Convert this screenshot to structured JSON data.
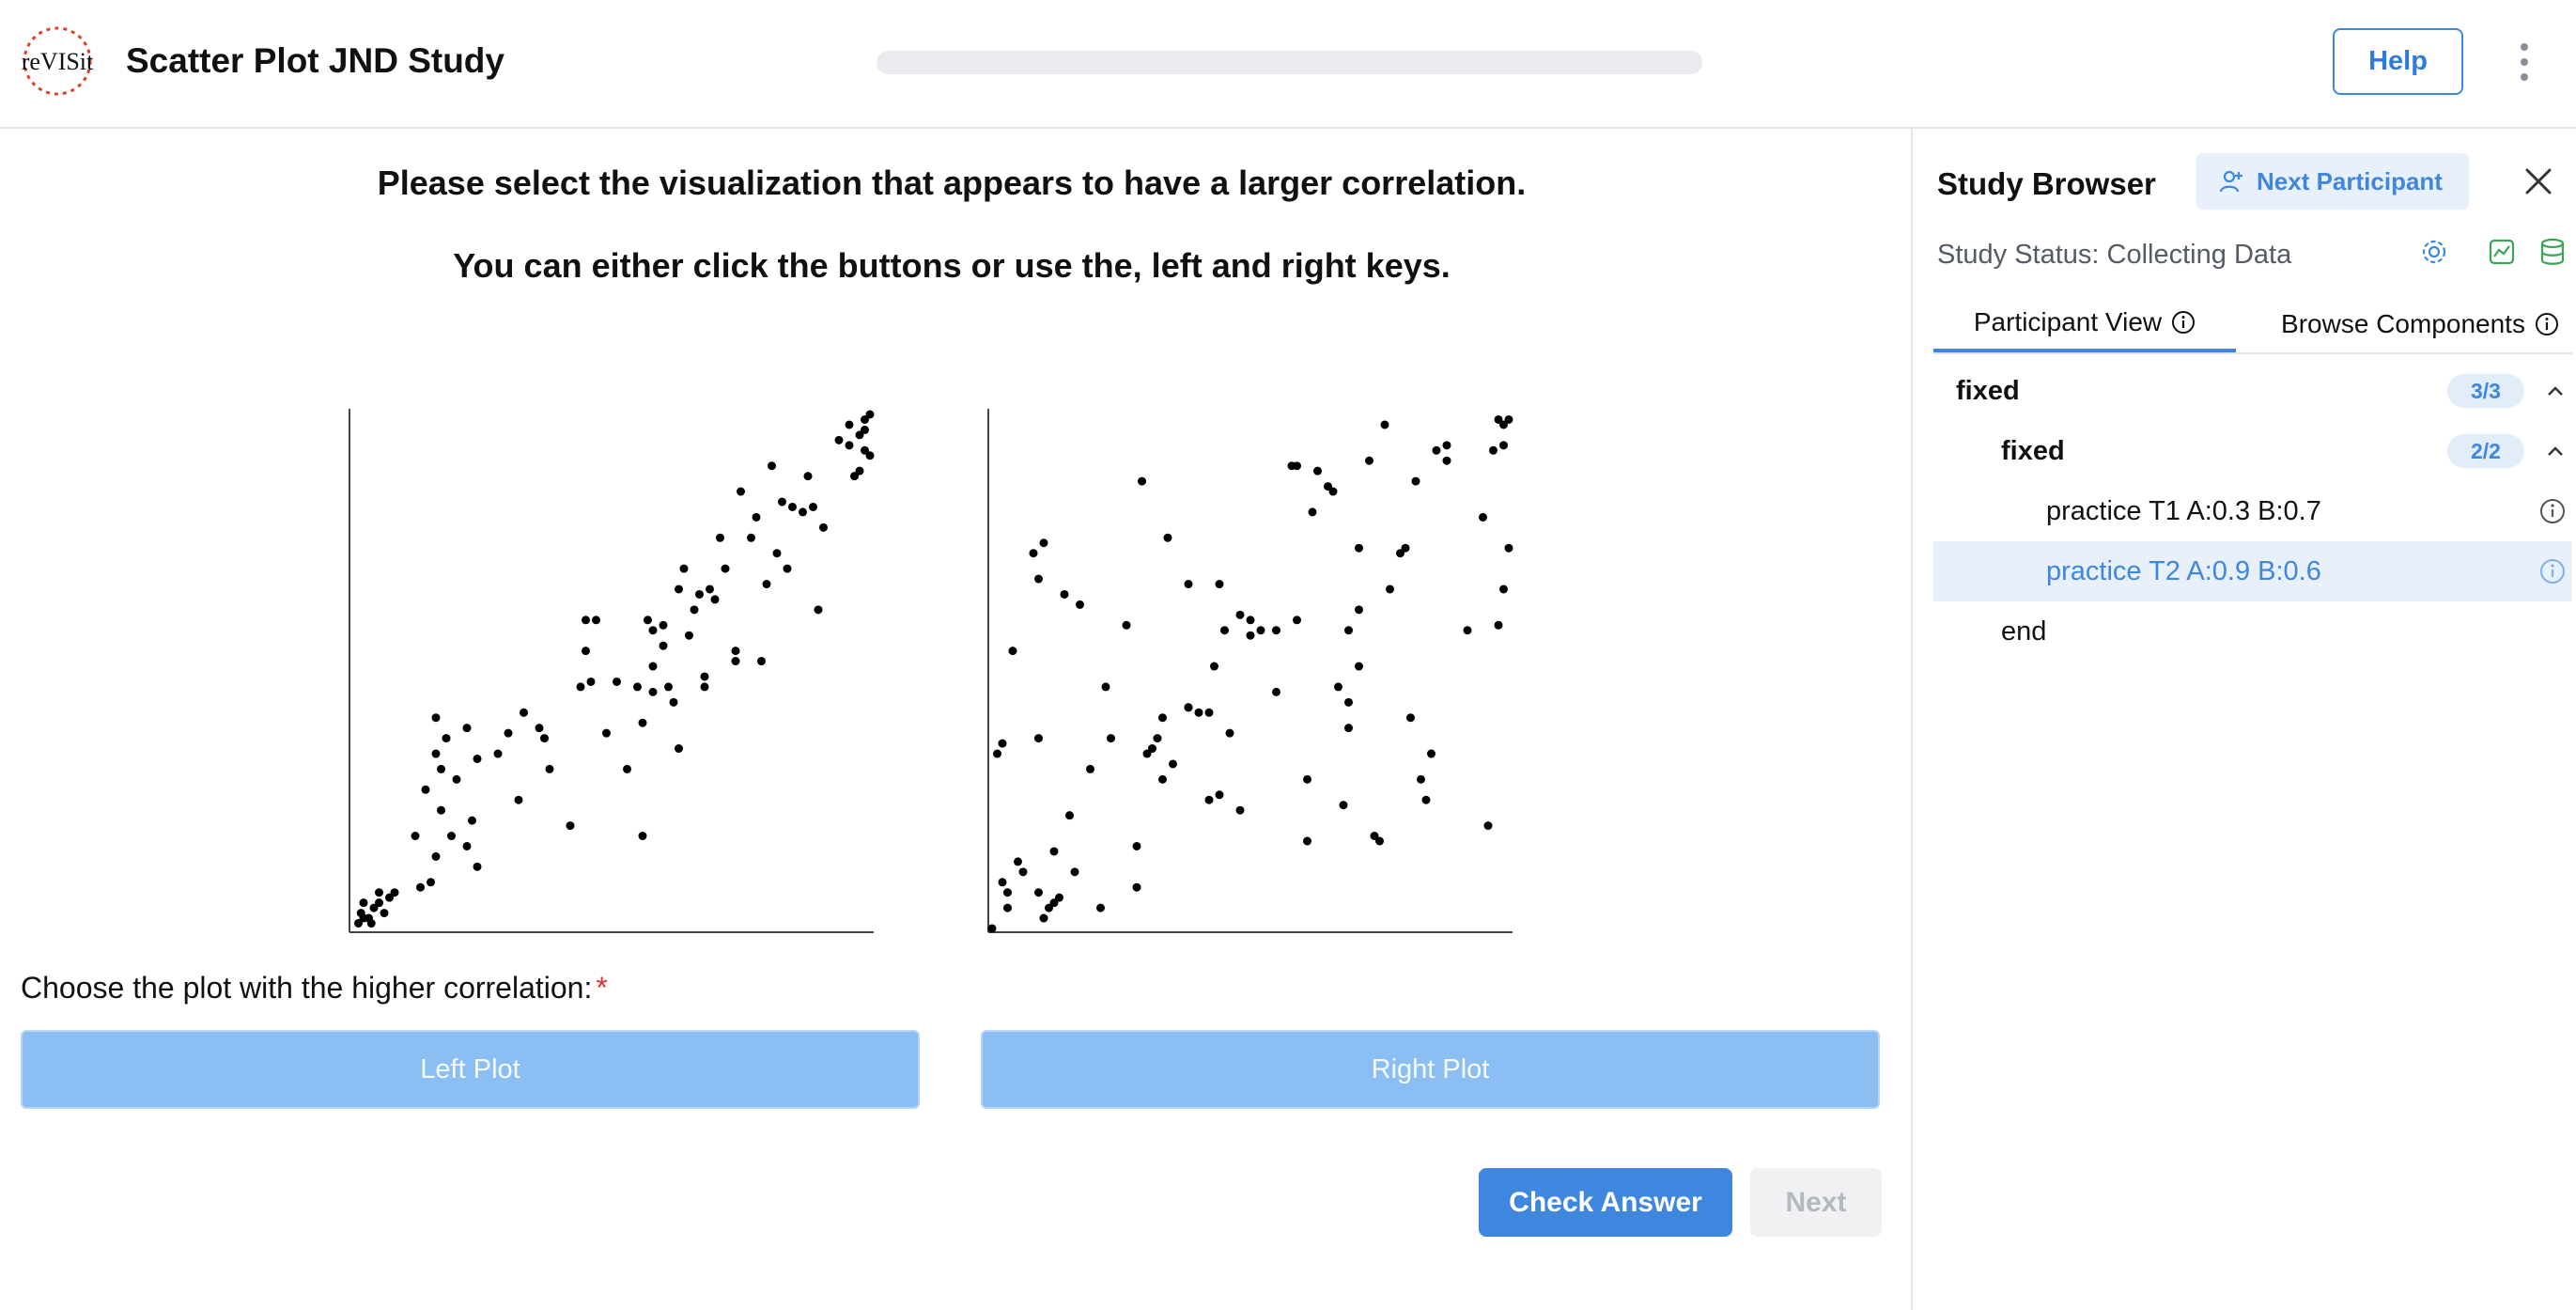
{
  "header": {
    "title": "Scatter Plot JND Study",
    "progress": 0.0,
    "help_label": "Help"
  },
  "main": {
    "instruction_1": "Please select the visualization that appears to have a larger correlation.",
    "instruction_2": "You can either click the buttons or use the, left and right keys.",
    "question": "Choose the plot with the higher correlation:",
    "required_mark": "*",
    "left_choice": "Left Plot",
    "right_choice": "Right Plot",
    "check_answer_label": "Check Answer",
    "next_label": "Next"
  },
  "sidebar": {
    "title": "Study Browser",
    "next_participant_label": "Next Participant",
    "status_text": "Study Status: Collecting Data",
    "tabs": [
      {
        "label": "Participant View",
        "active": true
      },
      {
        "label": "Browse Components",
        "active": false
      }
    ],
    "tree": {
      "group_1": {
        "label": "fixed",
        "badge": "3/3"
      },
      "group_2": {
        "label": "fixed",
        "badge": "2/2"
      },
      "items": [
        {
          "label": "practice T1 A:0.3 B:0.7",
          "selected": false
        },
        {
          "label": "practice T2 A:0.9 B:0.6",
          "selected": true
        }
      ],
      "end_label": "end"
    }
  },
  "colors": {
    "accent": "#3f87de",
    "choice_button": "#8bbff3",
    "selected_row": "#e7f0fb",
    "status_icon_green": "#3aa655",
    "required": "#e03131"
  },
  "icons": [
    "revisit-logo",
    "kebab-menu-icon",
    "user-plus-icon",
    "close-icon",
    "settings-icon",
    "chart-icon",
    "database-icon",
    "info-icon",
    "chevron-up-icon"
  ],
  "chart_data": [
    {
      "type": "scatter",
      "name": "left-plot",
      "xlim": [
        0,
        1
      ],
      "ylim": [
        0,
        1
      ],
      "points": [
        [
          0.01,
          0.01
        ],
        [
          0.02,
          0.02
        ],
        [
          0.015,
          0.03
        ],
        [
          0.03,
          0.02
        ],
        [
          0.04,
          0.04
        ],
        [
          0.05,
          0.05
        ],
        [
          0.06,
          0.03
        ],
        [
          0.07,
          0.06
        ],
        [
          0.05,
          0.07
        ],
        [
          0.08,
          0.07
        ],
        [
          0.02,
          0.05
        ],
        [
          0.035,
          0.01
        ],
        [
          0.13,
          0.08
        ],
        [
          0.15,
          0.09
        ],
        [
          0.16,
          0.14
        ],
        [
          0.12,
          0.18
        ],
        [
          0.17,
          0.23
        ],
        [
          0.19,
          0.18
        ],
        [
          0.22,
          0.16
        ],
        [
          0.24,
          0.12
        ],
        [
          0.14,
          0.27
        ],
        [
          0.16,
          0.34
        ],
        [
          0.17,
          0.31
        ],
        [
          0.2,
          0.29
        ],
        [
          0.23,
          0.21
        ],
        [
          0.18,
          0.37
        ],
        [
          0.16,
          0.41
        ],
        [
          0.22,
          0.39
        ],
        [
          0.24,
          0.33
        ],
        [
          0.28,
          0.34
        ],
        [
          0.32,
          0.25
        ],
        [
          0.3,
          0.38
        ],
        [
          0.33,
          0.42
        ],
        [
          0.36,
          0.39
        ],
        [
          0.37,
          0.37
        ],
        [
          0.38,
          0.31
        ],
        [
          0.42,
          0.2
        ],
        [
          0.45,
          0.54
        ],
        [
          0.46,
          0.48
        ],
        [
          0.47,
          0.6
        ],
        [
          0.49,
          0.38
        ],
        [
          0.55,
          0.47
        ],
        [
          0.53,
          0.31
        ],
        [
          0.56,
          0.18
        ],
        [
          0.58,
          0.51
        ],
        [
          0.58,
          0.46
        ],
        [
          0.6,
          0.55
        ],
        [
          0.6,
          0.59
        ],
        [
          0.62,
          0.44
        ],
        [
          0.63,
          0.35
        ],
        [
          0.64,
          0.7
        ],
        [
          0.65,
          0.57
        ],
        [
          0.66,
          0.62
        ],
        [
          0.67,
          0.65
        ],
        [
          0.68,
          0.49
        ],
        [
          0.69,
          0.66
        ],
        [
          0.7,
          0.64
        ],
        [
          0.71,
          0.76
        ],
        [
          0.72,
          0.7
        ],
        [
          0.74,
          0.52
        ],
        [
          0.74,
          0.54
        ],
        [
          0.75,
          0.85
        ],
        [
          0.77,
          0.76
        ],
        [
          0.78,
          0.8
        ],
        [
          0.79,
          0.52
        ],
        [
          0.8,
          0.67
        ],
        [
          0.81,
          0.9
        ],
        [
          0.82,
          0.73
        ],
        [
          0.83,
          0.83
        ],
        [
          0.84,
          0.7
        ],
        [
          0.85,
          0.82
        ],
        [
          0.87,
          0.81
        ],
        [
          0.88,
          0.88
        ],
        [
          0.89,
          0.82
        ],
        [
          0.91,
          0.78
        ],
        [
          0.9,
          0.62
        ],
        [
          0.94,
          0.95
        ],
        [
          0.96,
          0.94
        ],
        [
          0.97,
          0.88
        ],
        [
          0.96,
          0.98
        ],
        [
          0.98,
          0.96
        ],
        [
          0.99,
          0.97
        ],
        [
          1.0,
          1.0
        ],
        [
          0.99,
          0.93
        ],
        [
          0.98,
          0.89
        ],
        [
          1.0,
          0.92
        ],
        [
          0.99,
          0.99
        ],
        [
          0.63,
          0.66
        ],
        [
          0.58,
          0.58
        ],
        [
          0.51,
          0.48
        ],
        [
          0.61,
          0.47
        ],
        [
          0.57,
          0.6
        ],
        [
          0.44,
          0.47
        ],
        [
          0.45,
          0.6
        ],
        [
          0.68,
          0.47
        ],
        [
          0.56,
          0.4
        ]
      ]
    },
    {
      "type": "scatter",
      "name": "right-plot",
      "xlim": [
        0,
        1
      ],
      "ylim": [
        0,
        1
      ],
      "points": [
        [
          0.0,
          0.0
        ],
        [
          0.01,
          0.34
        ],
        [
          0.02,
          0.36
        ],
        [
          0.02,
          0.09
        ],
        [
          0.03,
          0.07
        ],
        [
          0.03,
          0.04
        ],
        [
          0.05,
          0.13
        ],
        [
          0.06,
          0.11
        ],
        [
          0.04,
          0.54
        ],
        [
          0.09,
          0.37
        ],
        [
          0.09,
          0.07
        ],
        [
          0.1,
          0.02
        ],
        [
          0.09,
          0.68
        ],
        [
          0.1,
          0.75
        ],
        [
          0.08,
          0.73
        ],
        [
          0.11,
          0.04
        ],
        [
          0.12,
          0.15
        ],
        [
          0.12,
          0.05
        ],
        [
          0.13,
          0.06
        ],
        [
          0.14,
          0.65
        ],
        [
          0.15,
          0.22
        ],
        [
          0.16,
          0.11
        ],
        [
          0.17,
          0.63
        ],
        [
          0.19,
          0.31
        ],
        [
          0.21,
          0.04
        ],
        [
          0.22,
          0.47
        ],
        [
          0.23,
          0.37
        ],
        [
          0.26,
          0.59
        ],
        [
          0.28,
          0.16
        ],
        [
          0.28,
          0.08
        ],
        [
          0.29,
          0.87
        ],
        [
          0.3,
          0.34
        ],
        [
          0.31,
          0.35
        ],
        [
          0.32,
          0.37
        ],
        [
          0.33,
          0.41
        ],
        [
          0.33,
          0.29
        ],
        [
          0.34,
          0.76
        ],
        [
          0.35,
          0.32
        ],
        [
          0.38,
          0.67
        ],
        [
          0.38,
          0.43
        ],
        [
          0.38,
          0.43
        ],
        [
          0.4,
          0.42
        ],
        [
          0.42,
          0.25
        ],
        [
          0.42,
          0.42
        ],
        [
          0.43,
          0.51
        ],
        [
          0.44,
          0.26
        ],
        [
          0.44,
          0.67
        ],
        [
          0.45,
          0.58
        ],
        [
          0.46,
          0.38
        ],
        [
          0.48,
          0.23
        ],
        [
          0.48,
          0.61
        ],
        [
          0.5,
          0.57
        ],
        [
          0.5,
          0.6
        ],
        [
          0.52,
          0.58
        ],
        [
          0.55,
          0.46
        ],
        [
          0.55,
          0.58
        ],
        [
          0.58,
          0.9
        ],
        [
          0.59,
          0.6
        ],
        [
          0.59,
          0.9
        ],
        [
          0.61,
          0.29
        ],
        [
          0.61,
          0.17
        ],
        [
          0.62,
          0.81
        ],
        [
          0.63,
          0.89
        ],
        [
          0.65,
          0.86
        ],
        [
          0.66,
          0.85
        ],
        [
          0.67,
          0.47
        ],
        [
          0.68,
          0.24
        ],
        [
          0.69,
          0.44
        ],
        [
          0.69,
          0.58
        ],
        [
          0.69,
          0.39
        ],
        [
          0.71,
          0.51
        ],
        [
          0.71,
          0.74
        ],
        [
          0.71,
          0.62
        ],
        [
          0.73,
          0.91
        ],
        [
          0.74,
          0.18
        ],
        [
          0.75,
          0.17
        ],
        [
          0.76,
          0.98
        ],
        [
          0.77,
          0.66
        ],
        [
          0.79,
          0.73
        ],
        [
          0.8,
          0.74
        ],
        [
          0.81,
          0.41
        ],
        [
          0.82,
          0.87
        ],
        [
          0.83,
          0.29
        ],
        [
          0.84,
          0.25
        ],
        [
          0.85,
          0.34
        ],
        [
          0.86,
          0.93
        ],
        [
          0.88,
          0.91
        ],
        [
          0.88,
          0.94
        ],
        [
          0.92,
          0.58
        ],
        [
          0.95,
          0.8
        ],
        [
          0.96,
          0.2
        ],
        [
          0.97,
          0.93
        ],
        [
          0.98,
          0.99
        ],
        [
          0.98,
          0.59
        ],
        [
          0.99,
          0.66
        ],
        [
          0.99,
          0.94
        ],
        [
          1.0,
          0.99
        ],
        [
          1.0,
          0.74
        ],
        [
          0.99,
          0.98
        ]
      ]
    }
  ]
}
